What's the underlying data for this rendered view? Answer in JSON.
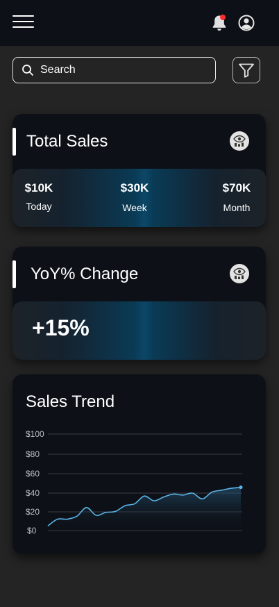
{
  "header": {
    "menu_icon": "hamburger-icon",
    "notification_icon": "bell-icon",
    "notification_dot_color": "#ff2d2d",
    "profile_icon": "user-circle-icon"
  },
  "search": {
    "placeholder": "Search",
    "icon": "search-icon"
  },
  "filter": {
    "icon": "filter-icon"
  },
  "total_sales": {
    "title": "Total Sales",
    "info_icon": "eye-graph-icon",
    "stats": [
      {
        "value": "$10K",
        "label": "Today"
      },
      {
        "value": "$30K",
        "label": "Week"
      },
      {
        "value": "$70K",
        "label": "Month"
      }
    ]
  },
  "yoy": {
    "title": "YoY% Change",
    "info_icon": "eye-graph-icon",
    "value": "+15%"
  },
  "sales_trend": {
    "title": "Sales Trend"
  },
  "chart_data": {
    "type": "area",
    "title": "Sales Trend",
    "xlabel": "",
    "ylabel": "",
    "ylim": [
      0,
      100
    ],
    "yticks": [
      "$0",
      "$20",
      "$40",
      "$60",
      "$80",
      "$100"
    ],
    "grid": true,
    "line_color": "#5ab4e6",
    "x": [
      0,
      1,
      2,
      3,
      4,
      5,
      6,
      7,
      8,
      9,
      10,
      11,
      12,
      13,
      14,
      15,
      16,
      17,
      18,
      19,
      20
    ],
    "values": [
      7,
      14,
      14,
      17,
      26,
      18,
      21,
      22,
      28,
      30,
      38,
      33,
      37,
      40,
      39,
      41,
      35,
      42,
      44,
      46,
      47
    ]
  }
}
